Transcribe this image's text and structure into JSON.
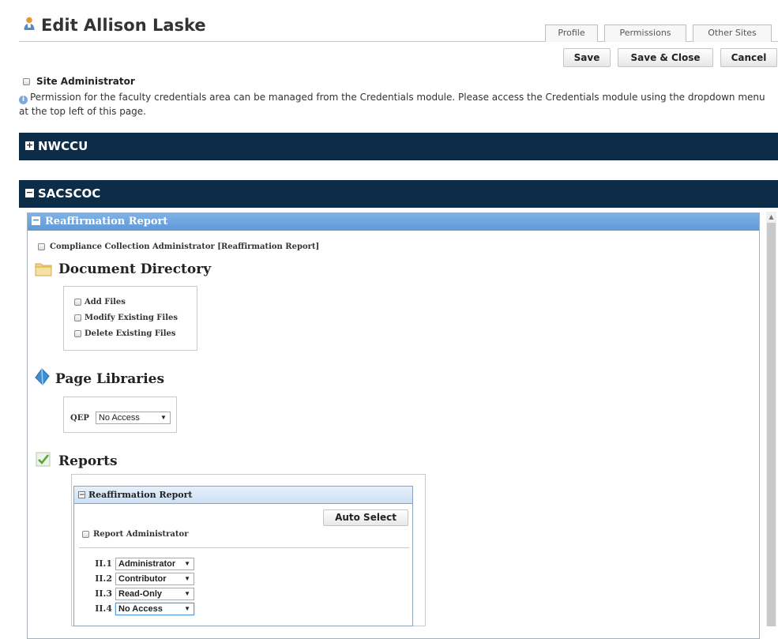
{
  "header": {
    "title": "Edit Allison Laske",
    "tabs": [
      "Profile",
      "Permissions",
      "Other Sites"
    ],
    "buttons": {
      "save": "Save",
      "save_close": "Save & Close",
      "cancel": "Cancel"
    }
  },
  "site_admin_label": "Site Administrator",
  "info_text": "Permission for the faculty credentials area can be managed from the Credentials module. Please access the Credentials module using the dropdown menu at the top left of this page.",
  "sections": {
    "nwccu": {
      "label": "NWCCU",
      "collapsed": true
    },
    "sacscoc": {
      "label": "SACSCOC",
      "collapsed": false
    }
  },
  "reaffirmation": {
    "header": "Reaffirmation Report",
    "compliance_label": "Compliance Collection Administrator [Reaffirmation Report]",
    "document_directory": {
      "title": "Document Directory",
      "permissions": [
        "Add Files",
        "Modify Existing Files",
        "Delete Existing Files"
      ]
    },
    "page_libraries": {
      "title": "Page Libraries",
      "qep_label": "QEP",
      "qep_value": "No Access"
    },
    "reports": {
      "title": "Reports",
      "inner_header": "Reaffirmation Report",
      "auto_select": "Auto Select",
      "report_admin": "Report Administrator",
      "items": [
        {
          "code": "II.1",
          "value": "Administrator"
        },
        {
          "code": "II.2",
          "value": "Contributor"
        },
        {
          "code": "II.3",
          "value": "Read-Only"
        },
        {
          "code": "II.4",
          "value": "No Access"
        }
      ]
    }
  },
  "colors": {
    "section_bar": "#0c2c47",
    "panel_header": "#6aa3dc",
    "accent_blue": "#5b9bd5"
  }
}
